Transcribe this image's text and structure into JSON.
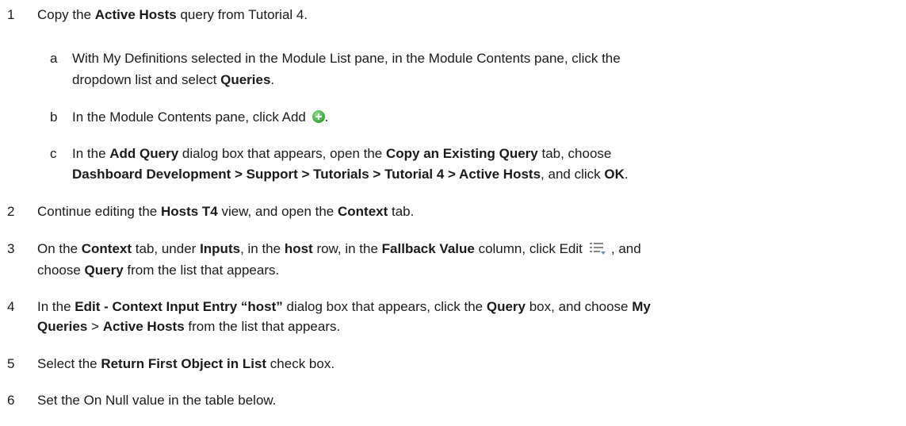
{
  "steps": [
    {
      "num": "1",
      "parts": [
        "Copy the ",
        "Active Hosts",
        " query from Tutorial 4."
      ]
    },
    {
      "num": "2",
      "parts": [
        "Continue editing the ",
        "Hosts T4",
        " view, and open the ",
        "Context",
        " tab."
      ]
    },
    {
      "num": "3",
      "parts": [
        "On the ",
        "Context",
        " tab, under ",
        "Inputs",
        ", in the ",
        "host",
        " row, in the ",
        "Fallback Value",
        " column, click Edit",
        ", and"
      ],
      "cont": [
        "choose ",
        "Query",
        " from the list that appears."
      ]
    },
    {
      "num": "4",
      "parts": [
        "In the ",
        "Edit - Context Input Entry “host”",
        " dialog box that appears, click the ",
        "Query",
        " box, and choose ",
        "My"
      ],
      "cont": [
        "Queries",
        " > ",
        "Active Hosts",
        " from the list that appears."
      ]
    },
    {
      "num": "5",
      "parts": [
        "Select the ",
        "Return First Object in List",
        " check box."
      ]
    },
    {
      "num": "6",
      "parts": [
        "Set the On Null value in the table below."
      ]
    }
  ],
  "substeps": [
    {
      "num": "a",
      "parts": [
        "With My Definitions selected in the Module List pane, in the Module Contents pane, click the"
      ],
      "cont": [
        "dropdown list and select ",
        "Queries",
        "."
      ]
    },
    {
      "num": "b",
      "parts": [
        "In the Module Contents pane, click Add",
        "."
      ]
    },
    {
      "num": "c",
      "parts": [
        "In the ",
        "Add Query",
        " dialog box that appears, open the ",
        "Copy an Existing Query",
        " tab, choose"
      ],
      "cont": [
        "Dashboard Development > Support > Tutorials > Tutorial 4 > Active Hosts",
        ", and click ",
        "OK",
        "."
      ]
    }
  ],
  "icons": {
    "add": "add-icon",
    "edit": "edit-list-icon"
  }
}
